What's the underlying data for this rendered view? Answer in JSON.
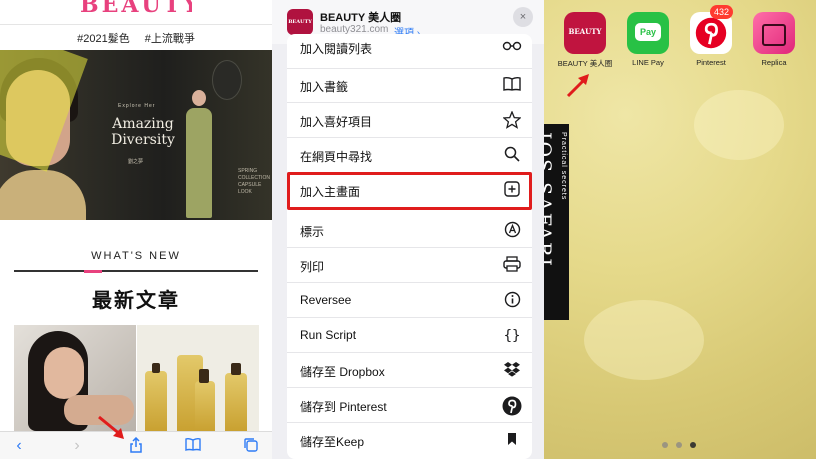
{
  "safari_page": {
    "logo": "BEAUTY",
    "tags": [
      "#2021髮色",
      "#上流戰爭"
    ],
    "hero": {
      "title_line1": "Amazing",
      "title_line2": "Diversity",
      "subtitle": "Explore Her",
      "caption": "劉之夢",
      "right_text_1": "SPRING",
      "right_text_2": "COLLECTION",
      "right_text_3": "CAPSULE LOOK"
    },
    "section_label": "WHAT'S NEW",
    "section_title": "最新文章",
    "toolbar": [
      "back-icon",
      "forward-icon",
      "share-icon",
      "bookmarks-icon",
      "tabs-icon"
    ]
  },
  "share_sheet": {
    "app_icon_text": "BEAUTY",
    "app_title": "BEAUTY 美人圈",
    "app_url": "beauty321.com",
    "options_label": "選項 ›",
    "close_icon": "×",
    "actions": [
      {
        "label": "加入閱讀列表",
        "icon": "reading-list-icon"
      },
      {
        "label": "加入書籤",
        "icon": "book-icon"
      },
      {
        "label": "加入喜好項目",
        "icon": "star-icon"
      },
      {
        "label": "在網頁中尋找",
        "icon": "search-icon"
      },
      {
        "label": "加入主畫面",
        "icon": "add-square-icon"
      },
      {
        "label": "標示",
        "icon": "markup-icon"
      },
      {
        "label": "列印",
        "icon": "printer-icon"
      },
      {
        "label": "Reversee",
        "icon": "info-circle-icon"
      },
      {
        "label": "Run Script",
        "icon": "braces-icon"
      },
      {
        "label": "儲存至 Dropbox",
        "icon": "dropbox-icon"
      },
      {
        "label": "儲存到 Pinterest",
        "icon": "pinterest-icon"
      },
      {
        "label": "儲存至Keep",
        "icon": "bookmark-icon"
      }
    ],
    "highlighted_action": "加入主畫面"
  },
  "home_screen": {
    "apps": [
      {
        "label": "BEAUTY 美人圈",
        "icon_text": "BEAUTY",
        "color": "#c0143f"
      },
      {
        "label": "LINE Pay",
        "icon_text": "Pay",
        "color": "#28c145"
      },
      {
        "label": "Pinterest",
        "icon_text": "P",
        "color": "#e60023"
      },
      {
        "label": "Replica",
        "icon_text": "",
        "color": "#ec3f86"
      }
    ],
    "pinterest_badge": "432",
    "overlay_title": "IOS SAFARI",
    "overlay_subtitle": "Practical secrets",
    "page_dots": 3,
    "active_dot": 3
  },
  "accent_colors": {
    "highlight": "#e01c1c",
    "ios_blue": "#2f7cf6",
    "brand_pink": "#e8417e"
  }
}
